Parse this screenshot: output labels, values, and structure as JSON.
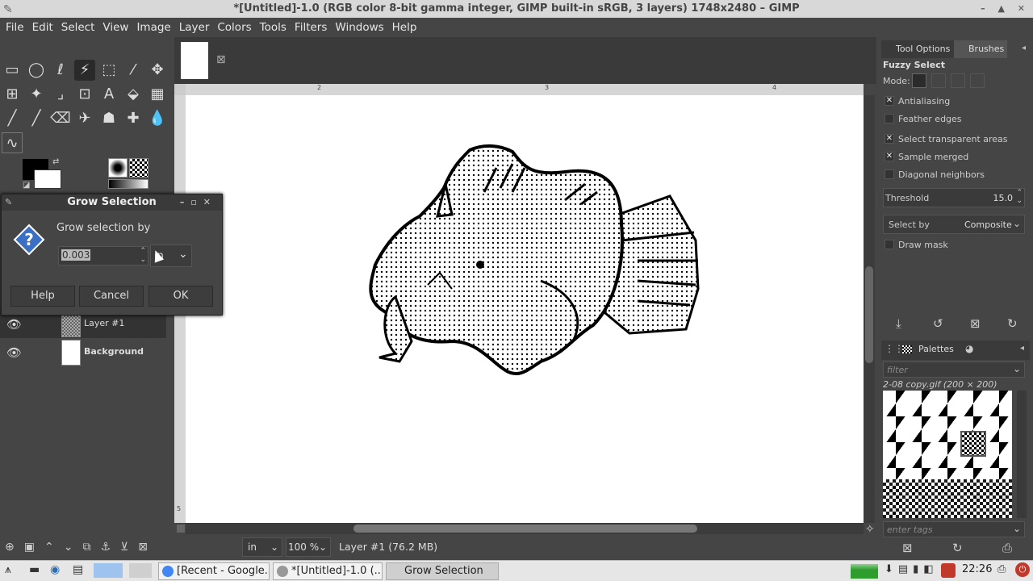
{
  "window": {
    "title": "*[Untitled]-1.0 (RGB color 8-bit gamma integer, GIMP built-in sRGB, 3 layers) 1748x2480 – GIMP",
    "controls": "– ▲ ✕"
  },
  "menu": [
    "File",
    "Edit",
    "Select",
    "View",
    "Image",
    "Layer",
    "Colors",
    "Tools",
    "Filters",
    "Windows",
    "Help"
  ],
  "layers": [
    {
      "name": "Layer #1",
      "bold": false
    },
    {
      "name": "Background",
      "bold": true
    }
  ],
  "rulers": {
    "h": [
      "2",
      "3",
      "4"
    ],
    "v": [
      "5"
    ]
  },
  "status": {
    "unit": "in",
    "zoom": "100 %",
    "layer_info": "Layer #1 (76.2 MB)"
  },
  "dialog": {
    "title": "Grow Selection",
    "prompt": "Grow selection by",
    "value": "0.003",
    "unit": "in",
    "help": "Help",
    "cancel": "Cancel",
    "ok": "OK"
  },
  "dock": {
    "tab_tool_options": "Tool Options",
    "tab_brushes": "Brushes",
    "tool_name": "Fuzzy Select",
    "mode_label": "Mode:",
    "options": [
      {
        "label": "Antialiasing",
        "checked": true
      },
      {
        "label": "Feather edges",
        "checked": false
      },
      {
        "label": "Select transparent areas",
        "checked": true
      },
      {
        "label": "Sample merged",
        "checked": true
      },
      {
        "label": "Diagonal neighbors",
        "checked": false
      }
    ],
    "threshold_label": "Threshold",
    "threshold_value": "15.0",
    "select_by_label": "Select by",
    "select_by_value": "Composite",
    "draw_mask": "Draw mask",
    "palettes_tab": "Palettes",
    "filter_placeholder": "filter",
    "pattern_name": "2-08 copy.gif (200 × 200)",
    "tags_placeholder": "enter tags"
  },
  "taskbar": {
    "tasks": [
      "[Recent - Google...",
      "*[Untitled]-1.0 (...",
      "Grow Selection"
    ],
    "clock": "22:26"
  }
}
